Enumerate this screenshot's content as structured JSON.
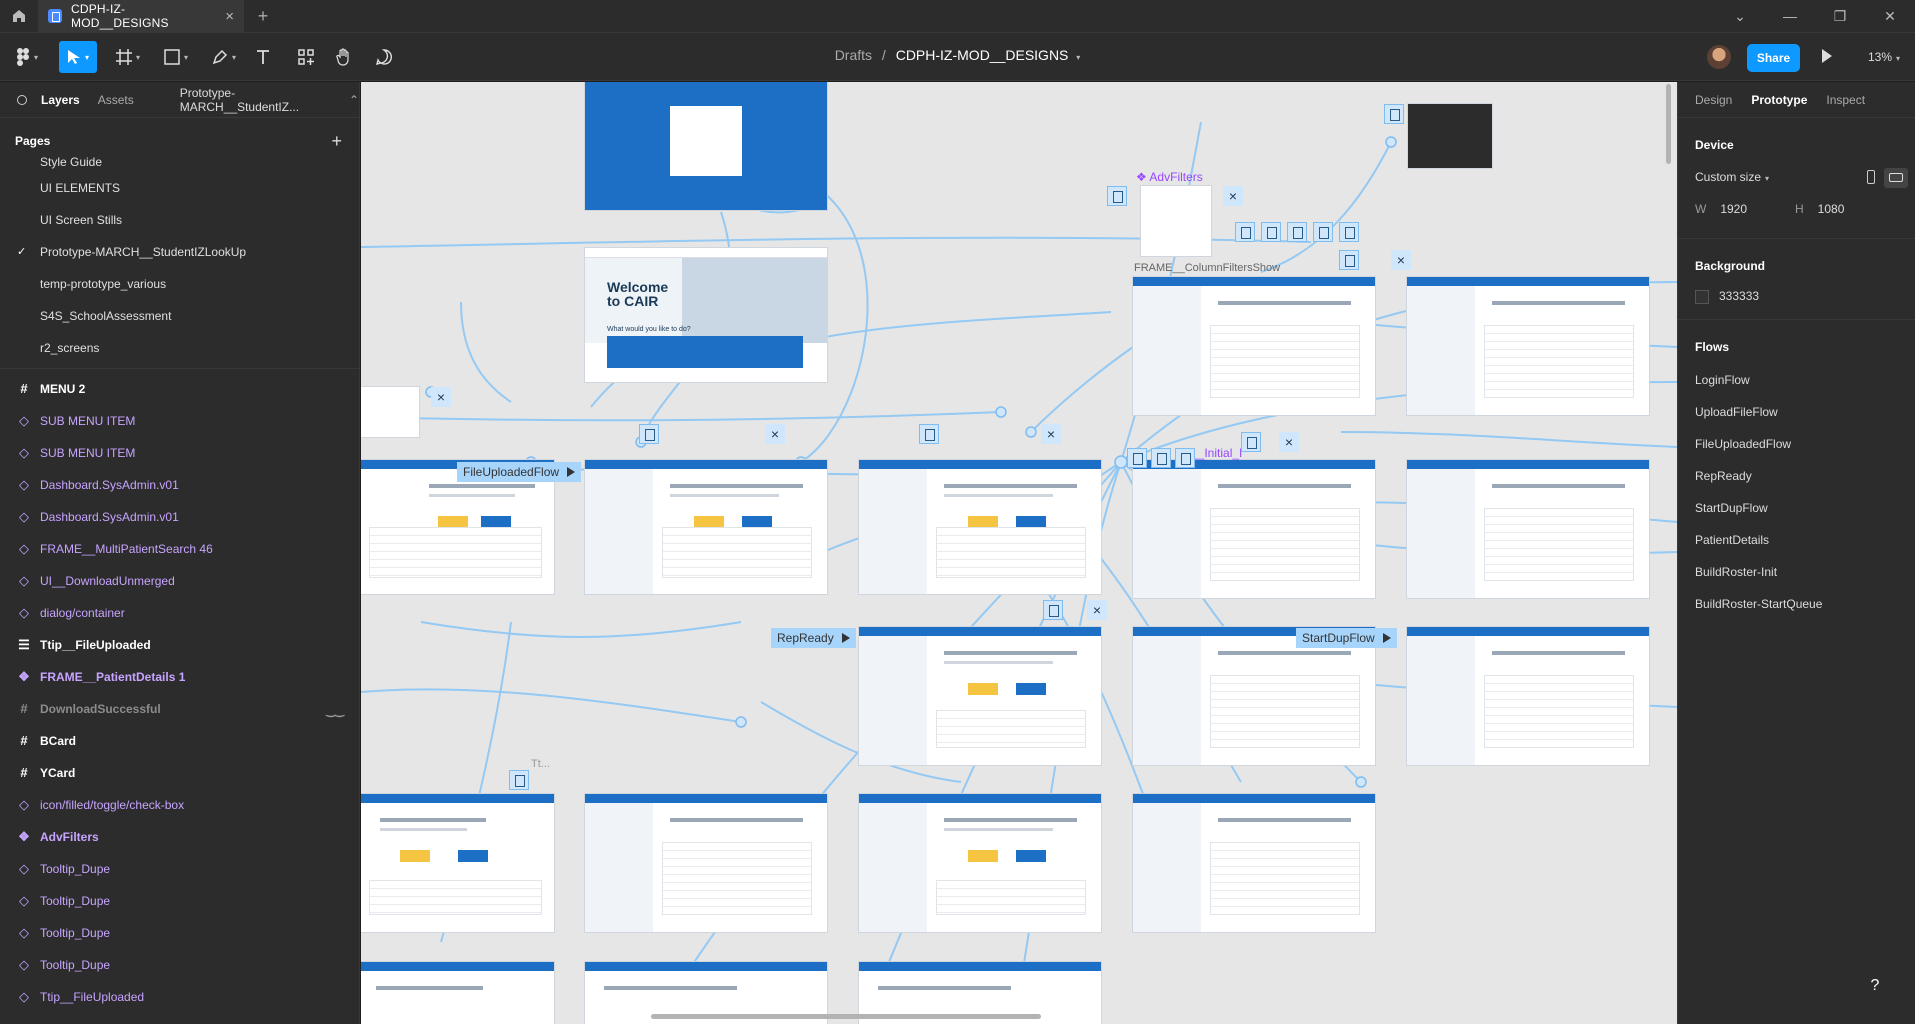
{
  "titlebar": {
    "tab_label": "CDPH-IZ-MOD__DESIGNS",
    "tab_close": "×",
    "new_tab": "+",
    "chevron": "⌄",
    "minimize": "—",
    "restore": "❐",
    "close": "✕"
  },
  "toolbar": {
    "breadcrumb_parent": "Drafts",
    "breadcrumb_sep": "/",
    "file_name": "CDPH-IZ-MOD__DESIGNS",
    "share_label": "Share",
    "zoom_label": "13%",
    "dropdown_caret": "▾"
  },
  "left_panel": {
    "tabs": {
      "layers": "Layers",
      "assets": "Assets",
      "current_page": "Prototype-MARCH__StudentIZ...",
      "page_caret": "⌃"
    },
    "pages_title": "Pages",
    "add_page": "+",
    "check_mark": "✓",
    "pages": [
      "Style Guide",
      "UI ELEMENTS",
      "UI Screen Stills",
      "Prototype-MARCH__StudentIZLookUp",
      "temp-prototype_various",
      "S4S_SchoolAssessment",
      "r2_screens"
    ],
    "layers": [
      {
        "label": "MENU 2",
        "icon": "#"
      },
      {
        "label": "SUB MENU ITEM",
        "icon": "◇"
      },
      {
        "label": "SUB MENU ITEM",
        "icon": "◇"
      },
      {
        "label": "Dashboard.SysAdmin.v01",
        "icon": "◇"
      },
      {
        "label": "Dashboard.SysAdmin.v01",
        "icon": "◇"
      },
      {
        "label": "FRAME__MultiPatientSearch 46",
        "icon": "◇"
      },
      {
        "label": "UI__DownloadUnmerged",
        "icon": "◇"
      },
      {
        "label": "dialog/container",
        "icon": "◇"
      },
      {
        "label": "Ttip__FileUploaded",
        "icon": "☰"
      },
      {
        "label": "FRAME__PatientDetails 1",
        "icon": "❖"
      },
      {
        "label": "DownloadSuccessful",
        "icon": "#"
      },
      {
        "label": "BCard",
        "icon": "#"
      },
      {
        "label": "YCard",
        "icon": "#"
      },
      {
        "label": "icon/filled/toggle/check-box",
        "icon": "◇"
      },
      {
        "label": "AdvFilters",
        "icon": "❖"
      },
      {
        "label": "Tooltip_Dupe",
        "icon": "◇"
      },
      {
        "label": "Tooltip_Dupe",
        "icon": "◇"
      },
      {
        "label": "Tooltip_Dupe",
        "icon": "◇"
      },
      {
        "label": "Tooltip_Dupe",
        "icon": "◇"
      },
      {
        "label": "Ttip__FileUploaded",
        "icon": "◇"
      }
    ]
  },
  "right_panel": {
    "tabs": {
      "design": "Design",
      "prototype": "Prototype",
      "inspect": "Inspect"
    },
    "device_title": "Device",
    "device_value": "Custom size",
    "w_label": "W",
    "w_value": "1920",
    "h_label": "H",
    "h_value": "1080",
    "background_title": "Background",
    "background_value": "333333",
    "flows_title": "Flows",
    "flows": [
      "LoginFlow",
      "UploadFileFlow",
      "FileUploadedFlow",
      "RepReady",
      "StartDupFlow",
      "PatientDetails",
      "BuildRoster-Init",
      "BuildRoster-StartQueue"
    ]
  },
  "canvas": {
    "welcome_line1": "Welcome",
    "welcome_line2": "to CAIR",
    "welcome_sub": "What would you like to do?",
    "adv_filters_label": "❖ AdvFilters",
    "column_filters_label": "FRAME__ColumnFiltersShow",
    "initial_label": "__Initial_I",
    "file_uploaded_flow": "FileUploadedFlow",
    "rep_ready_flow": "RepReady",
    "start_dup_flow": "StartDupFlow",
    "tt_label": "Tt...",
    "close_glyph": "×"
  },
  "help_label": "?"
}
